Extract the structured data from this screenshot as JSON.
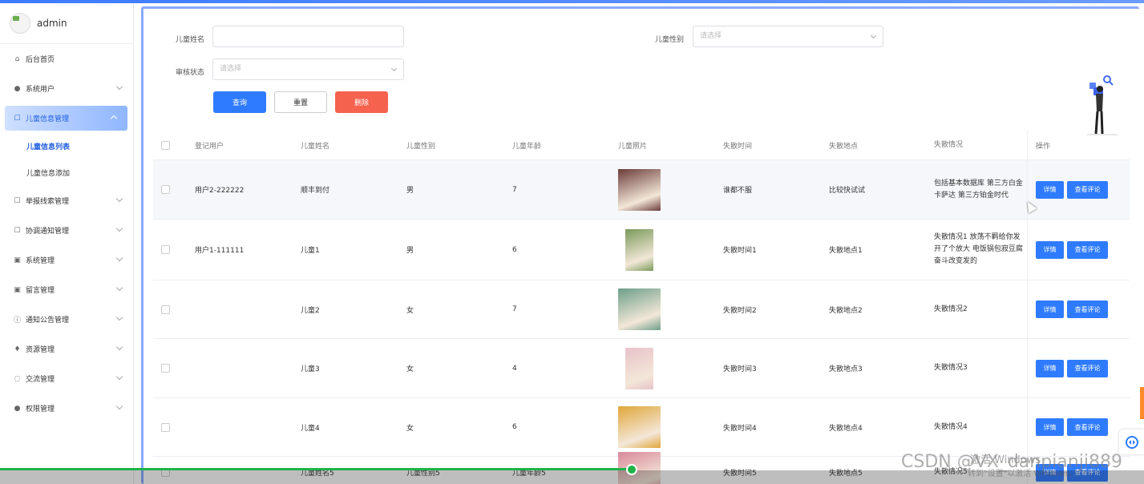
{
  "user": {
    "name": "admin"
  },
  "sidebar": {
    "items": [
      {
        "label": "后台首页",
        "icon": "home-icon",
        "has_children": false
      },
      {
        "label": "系统用户",
        "icon": "user-icon",
        "has_children": true
      },
      {
        "label": "儿童信息管理",
        "icon": "edit-icon",
        "has_children": true,
        "expanded": true,
        "children": [
          {
            "label": "儿童信息列表",
            "selected": true
          },
          {
            "label": "儿童信息添加",
            "selected": false
          }
        ]
      },
      {
        "label": "举报线索管理",
        "icon": "edit-icon",
        "has_children": true
      },
      {
        "label": "协调通知管理",
        "icon": "edit-icon",
        "has_children": true
      },
      {
        "label": "系统管理",
        "icon": "picture-icon",
        "has_children": true
      },
      {
        "label": "留言管理",
        "icon": "picture-icon",
        "has_children": true
      },
      {
        "label": "通知公告管理",
        "icon": "info-icon",
        "has_children": true
      },
      {
        "label": "资源管理",
        "icon": "location-icon",
        "has_children": true
      },
      {
        "label": "交流管理",
        "icon": "chat-icon",
        "has_children": true
      },
      {
        "label": "权限管理",
        "icon": "user-icon",
        "has_children": true
      }
    ]
  },
  "search": {
    "child_name_label": "儿童姓名",
    "child_name_value": "",
    "child_gender_label": "儿童性别",
    "child_gender_placeholder": "请选择",
    "review_status_label": "审核状态",
    "review_status_placeholder": "请选择",
    "query_button": "查询",
    "reset_button": "重置",
    "delete_button": "删除"
  },
  "table": {
    "columns": [
      "登记用户",
      "儿童姓名",
      "儿童性别",
      "儿童年龄",
      "儿童照片",
      "失散时间",
      "失散地点",
      "失散情况",
      "操作"
    ],
    "detail_label": "详情",
    "comment_label": "查看评论",
    "rows": [
      {
        "user": "用户2-222222",
        "name": "顺丰到付",
        "gender": "男",
        "age": "7",
        "time": "谁都不服",
        "place": "比较快试试",
        "condition": "包括基本数据库 第三方白金卡萨达 第三方铂金时代",
        "photo_color": "#6b3c3a",
        "photo_w": 53
      },
      {
        "user": "用户1-111111",
        "name": "儿童1",
        "gender": "男",
        "age": "6",
        "time": "失散时间1",
        "place": "失散地点1",
        "condition": "失散情况1 放荡不羁给你发开了个放大 电饭锅包寂豆腐奋斗改变发的",
        "photo_color": "#7a9a5a",
        "photo_w": 35
      },
      {
        "user": "",
        "name": "儿童2",
        "gender": "女",
        "age": "7",
        "time": "失散时间2",
        "place": "失散地点2",
        "condition": "失散情况2",
        "photo_color": "#6d9f8a",
        "photo_w": 53
      },
      {
        "user": "",
        "name": "儿童3",
        "gender": "女",
        "age": "4",
        "time": "失散时间3",
        "place": "失散地点3",
        "condition": "失散情况3",
        "photo_color": "#e8c2c9",
        "photo_w": 35
      },
      {
        "user": "",
        "name": "儿童4",
        "gender": "女",
        "age": "6",
        "time": "失散时间4",
        "place": "失散地点4",
        "condition": "失散情况4",
        "photo_color": "#e1a63a",
        "photo_w": 53
      },
      {
        "user": "",
        "name": "儿童姓名5",
        "gender": "儿童性别5",
        "age": "儿童年龄5",
        "time": "失散时间5",
        "place": "失散地点5",
        "condition": "失散情况5",
        "photo_color": "#d9889a",
        "photo_w": 53
      }
    ]
  },
  "watermarks": {
    "activate_windows": "激活 Windows",
    "activate_sub": "转到\"设置\"以激活 Windows。",
    "csdn": "CSDN @VX_danpianji889"
  }
}
